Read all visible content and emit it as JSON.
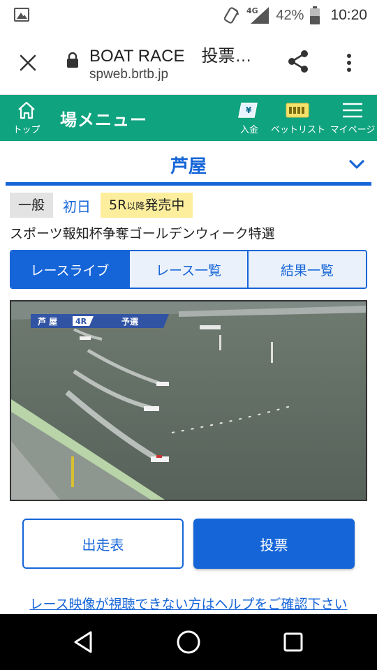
{
  "status_bar": {
    "network": "4G",
    "battery": "42%",
    "time": "10:20",
    "icons": [
      "gallery-icon",
      "hotspot-icon",
      "signal-icon",
      "battery-icon"
    ]
  },
  "browser": {
    "title": "BOAT RACE　投票…",
    "url": "spweb.brtb.jp"
  },
  "header": {
    "top_label": "トップ",
    "menu_title": "場メニュー",
    "deposit_label": "入金",
    "bet_list_label": "ベットリスト",
    "my_page_label": "マイページ",
    "accent": "#0fa37f"
  },
  "venue": {
    "name": "芦屋"
  },
  "tags": {
    "grade": "一般",
    "day": "初日",
    "sale_race": "5R",
    "sale_suffix": "以降",
    "sale_status": "発売中"
  },
  "race_name": "スポーツ報知杯争奪ゴールデンウィーク特選",
  "tabs": [
    {
      "label": "レースライブ",
      "active": true
    },
    {
      "label": "レース一覧",
      "active": false
    },
    {
      "label": "結果一覧",
      "active": false
    }
  ],
  "video_overlay": {
    "venue": "芦 屋",
    "race": "4R",
    "type": "予選"
  },
  "buttons": {
    "entries": "出走表",
    "vote": "投票"
  },
  "help_link": "レース映像が視聴できない方はヘルプをご確認下さい",
  "colors": {
    "primary": "#1565d8",
    "yellow_tag": "#fcee9c"
  }
}
